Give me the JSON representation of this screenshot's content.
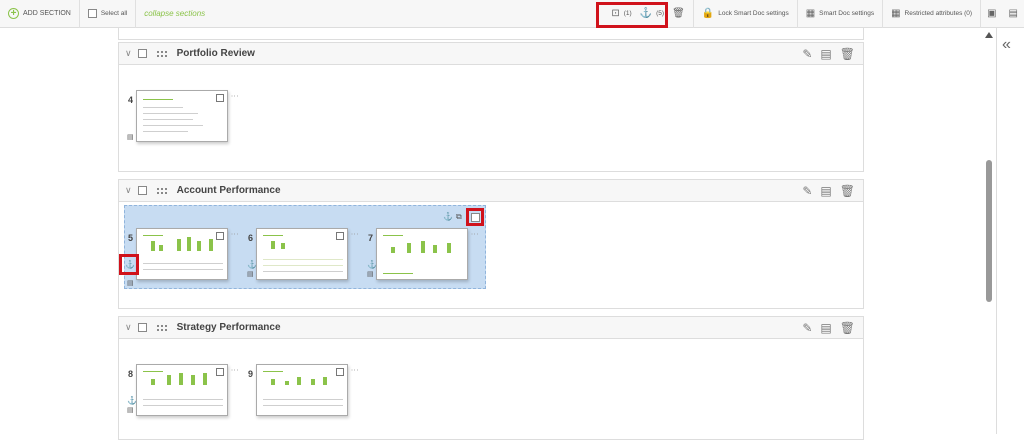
{
  "toolbar": {
    "add_section": "ADD SECTION",
    "select_all": "Select all",
    "collapse_sections": "collapse sections",
    "selection_count": "(1)",
    "anchor_count": "(5)",
    "lock_smart_doc": "Lock Smart Doc settings",
    "smart_doc_settings": "Smart Doc settings",
    "restricted_attributes": "Restricted attributes (0)"
  },
  "sections": [
    {
      "title": "Portfolio Review",
      "pages": [
        "4"
      ]
    },
    {
      "title": "Account Performance",
      "pages": [
        "5",
        "6",
        "7"
      ]
    },
    {
      "title": "Strategy Performance",
      "pages": [
        "8",
        "9"
      ]
    }
  ],
  "colors": {
    "accent": "#8bc34a",
    "selection": "#c7dcf2",
    "highlight": "#d0121b"
  },
  "icons": [
    "add-circle-icon",
    "select-icon",
    "anchor-icon",
    "trash-icon",
    "lock-icon",
    "grid-icon",
    "edit-icon",
    "document-icon",
    "chevron-double-left-icon"
  ]
}
